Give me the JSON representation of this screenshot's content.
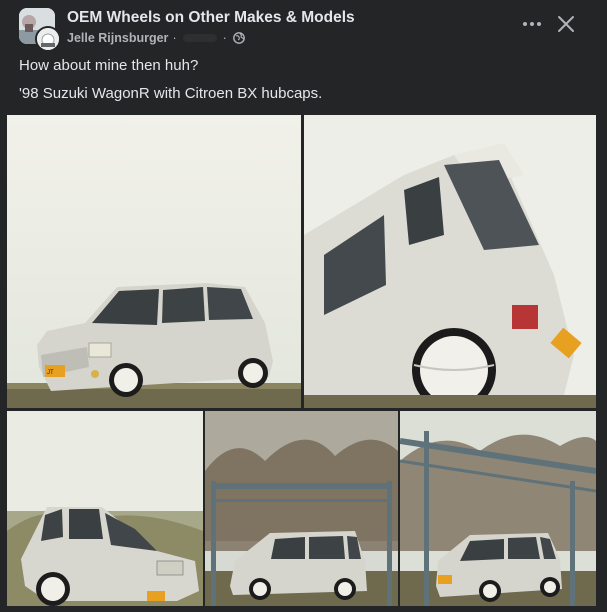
{
  "post": {
    "group_name": "OEM Wheels on Other Makes & Models",
    "author": "Jelle Rijnsburger",
    "separator": "·",
    "separator2": "·",
    "text_line1": "How about mine then huh?",
    "text_line2": "'98 Suzuki WagonR with Citroen BX hubcaps.",
    "icons": {
      "more": "more-dots-icon",
      "close": "close-icon",
      "privacy": "globe-icon"
    }
  },
  "photos": [
    {
      "label": "front three-quarter view of silver car"
    },
    {
      "label": "rear corner view of silver car"
    },
    {
      "label": "low front view of silver car"
    },
    {
      "label": "side view of car under pergola"
    },
    {
      "label": "front view of car under pergola"
    }
  ],
  "plates": {
    "plate1": "JT 5X-42"
  },
  "colors": {
    "background": "#242526",
    "text": "#e4e6eb",
    "muted": "#b0b3b8"
  }
}
